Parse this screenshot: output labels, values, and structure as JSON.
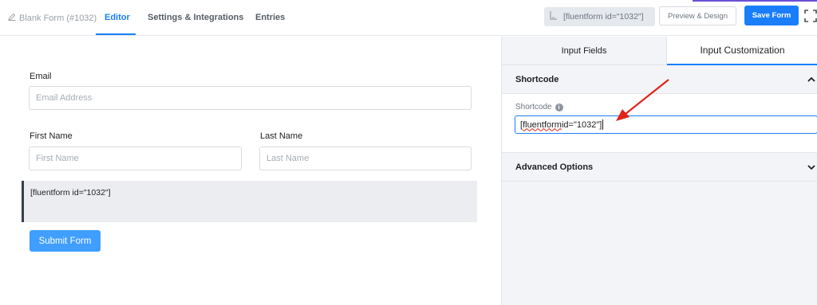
{
  "header": {
    "form_title": "Blank Form (#1032)",
    "tabs": [
      {
        "label": "Editor",
        "active": true
      },
      {
        "label": "Settings & Integrations",
        "active": false
      },
      {
        "label": "Entries",
        "active": false
      }
    ],
    "shortcode_chip": "[fluentform id=\"1032\"]",
    "preview_label": "Preview & Design",
    "save_label": "Save Form"
  },
  "form": {
    "email": {
      "label": "Email",
      "placeholder": "Email Address"
    },
    "first_name": {
      "label": "First Name",
      "placeholder": "First Name"
    },
    "last_name": {
      "label": "Last Name",
      "placeholder": "Last Name"
    },
    "shortcode_block": "[fluentform id=\"1032\"]",
    "submit_label": "Submit Form"
  },
  "panel": {
    "tabs": [
      {
        "label": "Input Fields",
        "active": false
      },
      {
        "label": "Input Customization",
        "active": true
      }
    ],
    "shortcode_section": {
      "title": "Shortcode",
      "field_label": "Shortcode",
      "value_part1": "fluentform",
      "value_part2": " id=\"1032\"]",
      "value_prefix": "["
    },
    "advanced_section": {
      "title": "Advanced Options"
    }
  },
  "colors": {
    "accent": "#1a7efb",
    "submit": "#409eff",
    "arrow": "#e2231a"
  }
}
